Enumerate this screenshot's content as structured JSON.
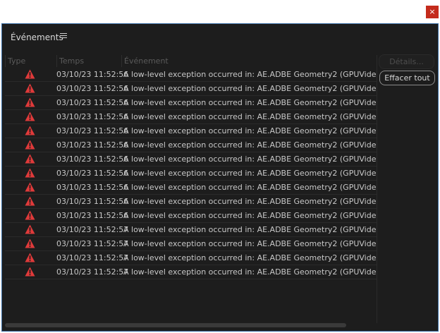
{
  "window": {
    "close_label": "×"
  },
  "panel": {
    "title": "Événements",
    "menu_icon": "hamburger-menu-icon"
  },
  "table": {
    "columns": [
      "Type",
      "Temps",
      "Événement"
    ],
    "rows": [
      {
        "type_icon": "warning-icon",
        "time": "03/10/23 11:52:56",
        "event": "A low-level exception occurred in: AE.ADBE Geometry2 (GPUVideoFitler:"
      },
      {
        "type_icon": "warning-icon",
        "time": "03/10/23 11:52:56",
        "event": "A low-level exception occurred in: AE.ADBE Geometry2 (GPUVideoFitler:"
      },
      {
        "type_icon": "warning-icon",
        "time": "03/10/23 11:52:56",
        "event": "A low-level exception occurred in: AE.ADBE Geometry2 (GPUVideoFitler:"
      },
      {
        "type_icon": "warning-icon",
        "time": "03/10/23 11:52:56",
        "event": "A low-level exception occurred in: AE.ADBE Geometry2 (GPUVideoFitler:"
      },
      {
        "type_icon": "warning-icon",
        "time": "03/10/23 11:52:56",
        "event": "A low-level exception occurred in: AE.ADBE Geometry2 (GPUVideoFitler:"
      },
      {
        "type_icon": "warning-icon",
        "time": "03/10/23 11:52:56",
        "event": "A low-level exception occurred in: AE.ADBE Geometry2 (GPUVideoFitler:"
      },
      {
        "type_icon": "warning-icon",
        "time": "03/10/23 11:52:56",
        "event": "A low-level exception occurred in: AE.ADBE Geometry2 (GPUVideoFitler:"
      },
      {
        "type_icon": "warning-icon",
        "time": "03/10/23 11:52:56",
        "event": "A low-level exception occurred in: AE.ADBE Geometry2 (GPUVideoFitler:"
      },
      {
        "type_icon": "warning-icon",
        "time": "03/10/23 11:52:56",
        "event": "A low-level exception occurred in: AE.ADBE Geometry2 (GPUVideoFitler:"
      },
      {
        "type_icon": "warning-icon",
        "time": "03/10/23 11:52:56",
        "event": "A low-level exception occurred in: AE.ADBE Geometry2 (GPUVideoFitler:"
      },
      {
        "type_icon": "warning-icon",
        "time": "03/10/23 11:52:56",
        "event": "A low-level exception occurred in: AE.ADBE Geometry2 (GPUVideoFitler:"
      },
      {
        "type_icon": "warning-icon",
        "time": "03/10/23 11:52:57",
        "event": "A low-level exception occurred in: AE.ADBE Geometry2 (GPUVideoFitler:"
      },
      {
        "type_icon": "warning-icon",
        "time": "03/10/23 11:52:57",
        "event": "A low-level exception occurred in: AE.ADBE Geometry2 (GPUVideoFitler:"
      },
      {
        "type_icon": "warning-icon",
        "time": "03/10/23 11:52:57",
        "event": "A low-level exception occurred in: AE.ADBE Geometry2 (GPUVideoFitler:"
      },
      {
        "type_icon": "warning-icon",
        "time": "03/10/23 11:52:57",
        "event": "A low-level exception occurred in: AE.ADBE Geometry2 (GPUVideoFitler:"
      }
    ]
  },
  "buttons": {
    "details_label": "Détails...",
    "clear_label": "Effacer tout"
  },
  "colors": {
    "background": "#1d1d1d",
    "warning": "#e03a3a",
    "border_accent": "#3a6ea5",
    "close": "#c42b1c"
  }
}
